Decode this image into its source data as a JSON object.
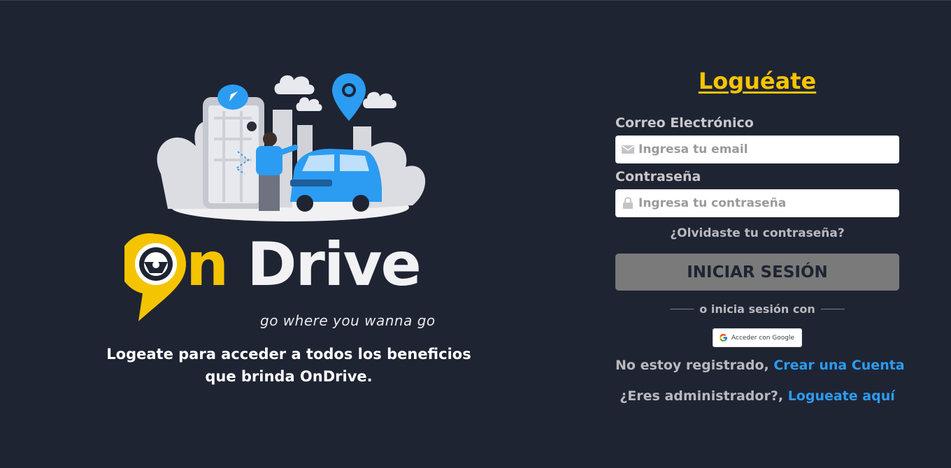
{
  "brand": {
    "name_part1": "O",
    "name_part2": "n",
    "name_part3": " Drive",
    "tagline": "go where you wanna go",
    "colors": {
      "yellow": "#f5c400",
      "blue": "#2b9cf2",
      "background": "#1f2433"
    }
  },
  "promo": {
    "line1": "Logeate para acceder a todos los beneficios",
    "line2": "que brinda OnDrive."
  },
  "form": {
    "title": "Loguéate",
    "email_label": "Correo Electrónico",
    "email_placeholder": "Ingresa tu email",
    "password_label": "Contraseña",
    "password_placeholder": "Ingresa tu contraseña",
    "forgot": "¿Olvidaste tu contraseña?",
    "submit": "INICIAR SESIÓN",
    "divider": "o inicia sesión con",
    "google": "Acceder con Google",
    "register_prefix": "No estoy registrado, ",
    "register_link": "Crear una Cuenta",
    "admin_prefix": "¿Eres administrador?, ",
    "admin_link": "Logueate aquí"
  },
  "icons": {
    "email": "envelope-icon",
    "password": "lock-icon",
    "google": "google-g-icon",
    "logo": "steering-pin-icon"
  }
}
